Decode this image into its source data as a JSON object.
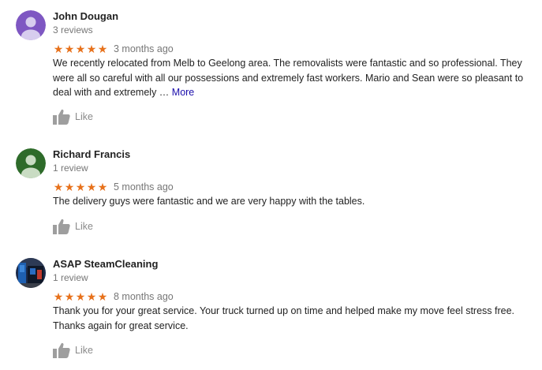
{
  "reviews": [
    {
      "name": "John Dougan",
      "review_count": "3 reviews",
      "rating": 5,
      "stars": "★★★★★",
      "date": "3 months ago",
      "text": "We recently relocated from Melb to Geelong area. The removalists were fantastic and so professional. They were all so careful with all our possessions and extremely fast workers. Mario and Sean were so pleasant to deal with and extremely …",
      "more_label": "More",
      "like_label": "Like",
      "avatar_color": "#7e57c2"
    },
    {
      "name": "Richard Francis",
      "review_count": "1 review",
      "rating": 5,
      "stars": "★★★★★",
      "date": "5 months ago",
      "text": "The delivery guys were fantastic and we are very happy with the tables.",
      "like_label": "Like",
      "avatar_color": "#2e6b2a"
    },
    {
      "name": "ASAP SteamCleaning",
      "review_count": "1 review",
      "rating": 5,
      "stars": "★★★★★",
      "date": "8 months ago",
      "text": "Thank you for your great service. Your truck turned up on time and helped make my move feel stress free. Thanks again for great service.",
      "like_label": "Like",
      "avatar_color": "#1c2a4a"
    }
  ],
  "colors": {
    "star": "#e7711b",
    "link": "#1a0dab",
    "muted": "#777777",
    "like_icon": "#9e9e9e"
  }
}
